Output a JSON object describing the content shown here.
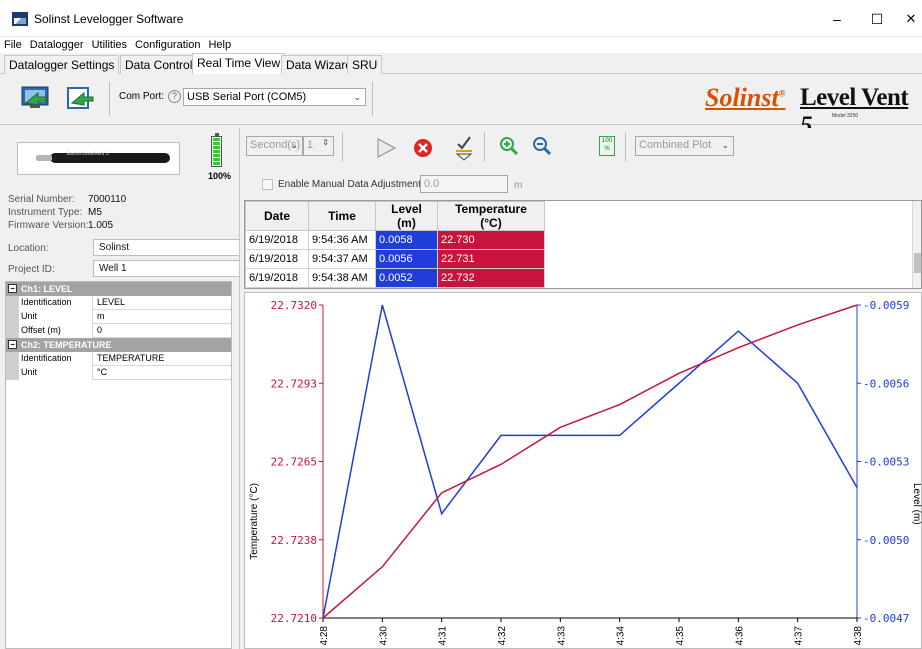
{
  "window": {
    "title": "Solinst Levelogger Software",
    "minimize": "–",
    "maximize": "☐",
    "close": "✕"
  },
  "menu": [
    "File",
    "Datalogger",
    "Utilities",
    "Configuration",
    "Help"
  ],
  "tabs": [
    {
      "label": "Datalogger Settings",
      "active": false
    },
    {
      "label": "Data Control",
      "active": false
    },
    {
      "label": "Real Time View",
      "active": true
    },
    {
      "label": "Data Wizard",
      "active": false
    },
    {
      "label": "SRU",
      "active": false
    }
  ],
  "toolbar": {
    "com_port_label": "Com Port:",
    "com_port_help": "?",
    "com_port_value": "USB Serial Port (COM5)",
    "brand": "Solinst",
    "brand_registered": "®",
    "product_name": "Level Vent",
    "product_number": "5",
    "model": "Model 3250"
  },
  "device": {
    "battery_label": "100%",
    "battery_level": 1.0,
    "serial_number_label": "Serial Number:",
    "serial_number": "7000110",
    "instrument_type_label": "Instrument Type:",
    "instrument_type": "M5",
    "firmware_version_label": "Firmware Version:",
    "firmware_version": "1.005",
    "location_label": "Location:",
    "location": "Solinst",
    "project_id_label": "Project ID:",
    "project_id": "Well 1"
  },
  "channels": [
    {
      "header": "Ch1: LEVEL",
      "rows": [
        {
          "key": "Identification",
          "value": "LEVEL"
        },
        {
          "key": "Unit",
          "value": "m"
        },
        {
          "key": "Offset (m)",
          "value": "0"
        }
      ]
    },
    {
      "header": "Ch2: TEMPERATURE",
      "rows": [
        {
          "key": "Identification",
          "value": "TEMPERATURE"
        },
        {
          "key": "Unit",
          "value": "°C"
        }
      ]
    }
  ],
  "realtime_toolbar": {
    "interval_unit": "Second(s)",
    "interval_value": "1",
    "plot_mode": "Combined Plot",
    "manual_adjust_label": "Enable Manual Data Adjustment:",
    "manual_adjust_value": "0.0",
    "manual_adjust_unit": "m",
    "zoom_fit_label": "100\n%"
  },
  "table": {
    "headers": [
      "Date",
      "Time",
      "Level (m)",
      "Temperature (°C)"
    ],
    "rows": [
      [
        "6/19/2018",
        "9:54:36 AM",
        "0.0058",
        "22.730"
      ],
      [
        "6/19/2018",
        "9:54:37 AM",
        "0.0056",
        "22.731"
      ],
      [
        "6/19/2018",
        "9:54:38 AM",
        "0.0052",
        "22.732"
      ]
    ]
  },
  "colors": {
    "level": "#1f3ddb",
    "temperature": "#c8143c",
    "brand": "#d35400"
  },
  "chart_data": {
    "type": "line",
    "title": "",
    "ylabel": "Temperature (°C)",
    "y2label": "Level (m)",
    "x": [
      "4:28",
      "4:30",
      "4:31",
      "4:32",
      "4:33",
      "4:34",
      "4:35",
      "4:36",
      "4:37",
      "4:38"
    ],
    "ylim": [
      22.721,
      22.732
    ],
    "y2lim": [
      0.0047,
      0.0059
    ],
    "yticks": [
      "22.7210",
      "22.7238",
      "22.7265",
      "22.7293",
      "22.7320"
    ],
    "y2ticks": [
      "0.0047",
      "0.0050",
      "0.0053",
      "0.0056",
      "0.0059"
    ],
    "series": [
      {
        "name": "Level (m)",
        "axis": "right",
        "values": [
          0.0047,
          0.0059,
          0.0051,
          0.0054,
          0.0054,
          0.0054,
          0.0056,
          0.0058,
          0.0056,
          0.0052
        ]
      },
      {
        "name": "Temperature (°C)",
        "axis": "left",
        "values": [
          22.721,
          22.7228,
          22.7254,
          22.7264,
          22.7277,
          22.7285,
          22.7296,
          22.7305,
          22.7313,
          22.732
        ]
      }
    ],
    "grid": false,
    "legend": "none"
  }
}
